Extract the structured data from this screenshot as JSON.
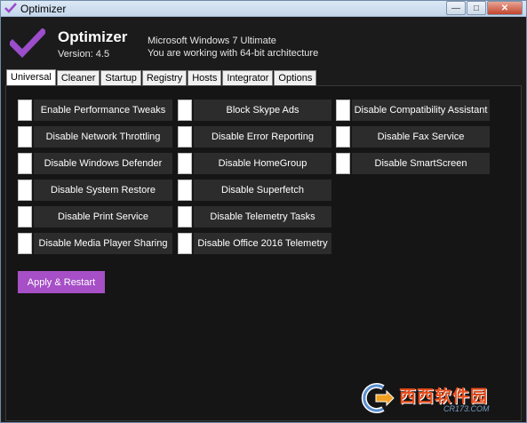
{
  "window": {
    "title": "Optimizer",
    "minimize_glyph": "—",
    "maximize_glyph": "□",
    "close_glyph": "✕"
  },
  "header": {
    "app_name": "Optimizer",
    "version": "Version: 4.5",
    "os_info": "Microsoft Windows 7 Ultimate",
    "arch_info": "You are working with 64-bit architecture",
    "accent_color": "#9b4dca"
  },
  "tabs": [
    {
      "label": "Universal",
      "active": true
    },
    {
      "label": "Cleaner"
    },
    {
      "label": "Startup"
    },
    {
      "label": "Registry"
    },
    {
      "label": "Hosts"
    },
    {
      "label": "Integrator"
    },
    {
      "label": "Options"
    }
  ],
  "options": {
    "col1": [
      "Enable Performance Tweaks",
      "Disable Network Throttling",
      "Disable Windows Defender",
      "Disable System Restore",
      "Disable Print Service",
      "Disable Media Player Sharing"
    ],
    "col2": [
      "Block Skype Ads",
      "Disable Error Reporting",
      "Disable HomeGroup",
      "Disable Superfetch",
      "Disable Telemetry Tasks",
      "Disable Office 2016 Telemetry"
    ],
    "col3": [
      "Disable Compatibility Assistant",
      "Disable Fax Service",
      "Disable SmartScreen"
    ]
  },
  "apply_button": "Apply & Restart",
  "watermark": {
    "main": "西西软件园",
    "sub": "CR173.COM"
  }
}
